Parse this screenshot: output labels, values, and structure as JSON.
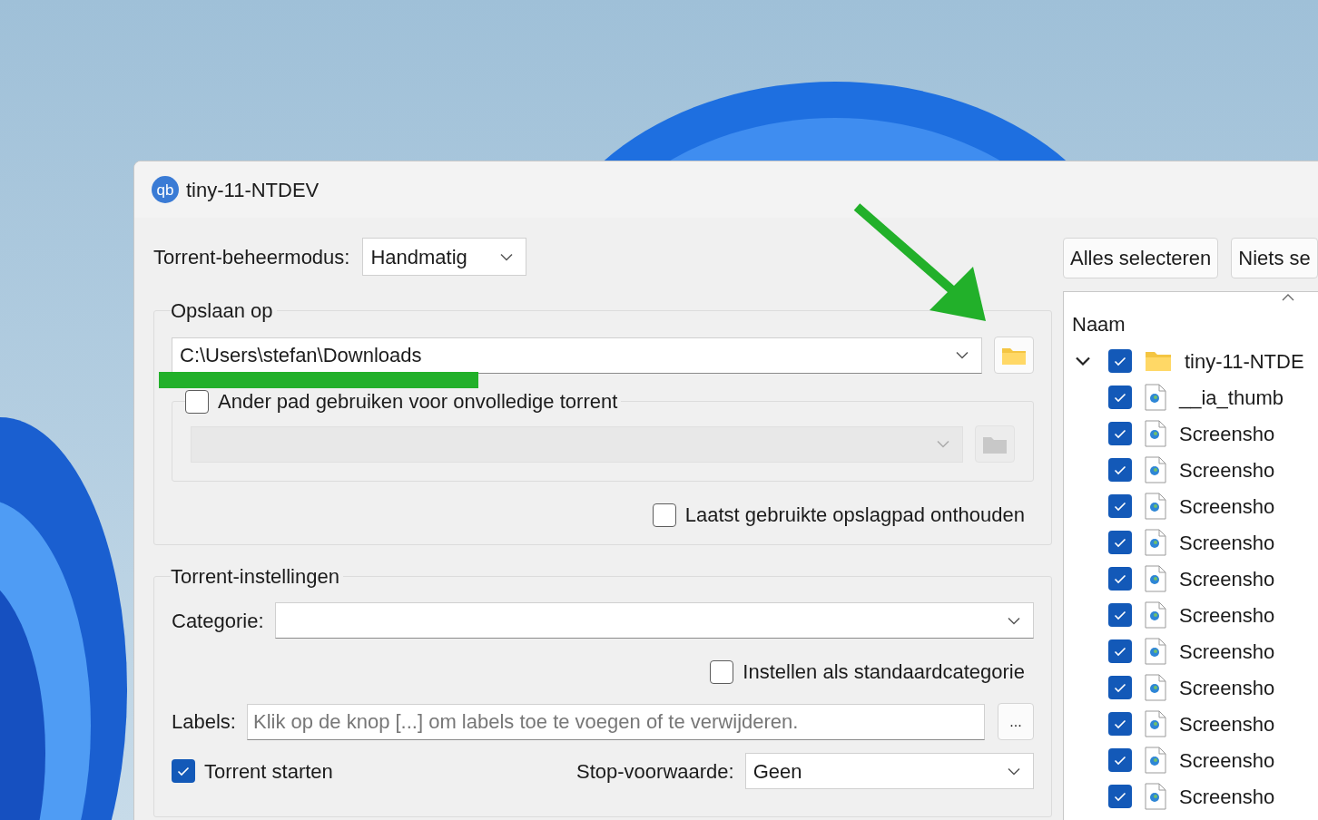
{
  "window": {
    "logo": "qb",
    "title": "tiny-11-NTDEV"
  },
  "management_mode": {
    "label": "Torrent-beheermodus:",
    "value": "Handmatig"
  },
  "save_location": {
    "title": "Opslaan op",
    "path": "C:\\Users\\stefan\\Downloads",
    "incomplete_path": {
      "label": "Ander pad gebruiken voor onvolledige torrent",
      "checked": false
    },
    "remember": {
      "label": "Laatst gebruikte opslagpad onthouden",
      "checked": false
    }
  },
  "torrent_settings": {
    "title": "Torrent-instellingen",
    "category": {
      "label": "Categorie:"
    },
    "default_category": {
      "label": "Instellen als standaardcategorie",
      "checked": false
    },
    "labels": {
      "label": "Labels:",
      "placeholder": "Klik op de knop [...] om labels toe te voegen of te verwijderen.",
      "button": "..."
    },
    "start_torrent": {
      "label": "Torrent starten",
      "checked": true
    },
    "stop_condition": {
      "label": "Stop-voorwaarde:",
      "value": "Geen"
    }
  },
  "files": {
    "buttons": [
      "Alles selecteren",
      "Niets se"
    ],
    "column": "Naam",
    "tree": [
      {
        "name": "tiny-11-NTDE",
        "kind": "folder",
        "checked": true,
        "expanded": true,
        "children": [
          {
            "name": "__ia_thumb",
            "kind": "file",
            "checked": true
          },
          {
            "name": "Screensho",
            "kind": "file",
            "checked": true
          },
          {
            "name": "Screensho",
            "kind": "file",
            "checked": true
          },
          {
            "name": "Screensho",
            "kind": "file",
            "checked": true
          },
          {
            "name": "Screensho",
            "kind": "file",
            "checked": true
          },
          {
            "name": "Screensho",
            "kind": "file",
            "checked": true
          },
          {
            "name": "Screensho",
            "kind": "file",
            "checked": true
          },
          {
            "name": "Screensho",
            "kind": "file",
            "checked": true
          },
          {
            "name": "Screensho",
            "kind": "file",
            "checked": true
          },
          {
            "name": "Screensho",
            "kind": "file",
            "checked": true
          },
          {
            "name": "Screensho",
            "kind": "file",
            "checked": true
          },
          {
            "name": "Screensho",
            "kind": "file",
            "checked": true
          }
        ]
      }
    ]
  }
}
